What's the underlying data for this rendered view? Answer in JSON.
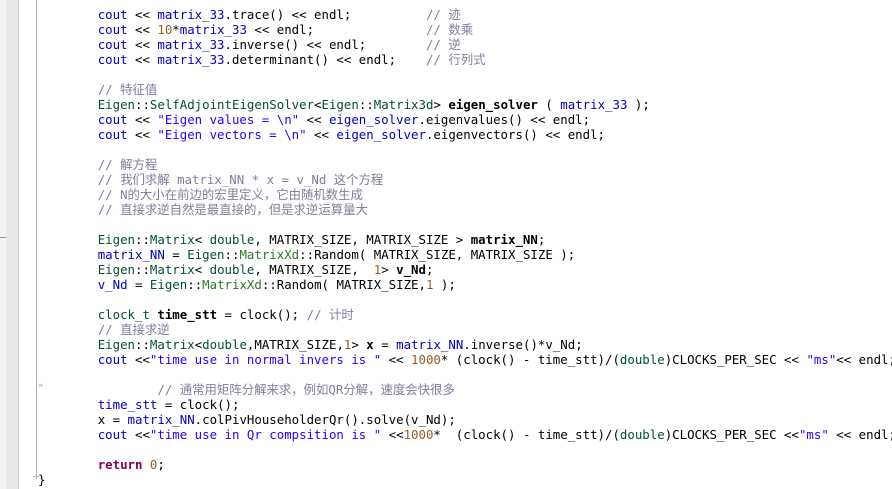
{
  "editor": {
    "lines": [
      {
        "indent": "    ",
        "tokens": [
          [
            "t-blue",
            "cout"
          ],
          [
            "t-plain",
            " << "
          ],
          [
            "t-blue",
            "matrix_33"
          ],
          [
            "t-plain",
            "."
          ],
          [
            "t-func",
            "trace"
          ],
          [
            "t-plain",
            "() << endl;"
          ],
          [
            "t-plain",
            "          "
          ],
          [
            "t-comment",
            "// 迹"
          ]
        ]
      },
      {
        "indent": "    ",
        "tokens": [
          [
            "t-blue",
            "cout"
          ],
          [
            "t-plain",
            " << "
          ],
          [
            "t-num",
            "10"
          ],
          [
            "t-plain",
            "*"
          ],
          [
            "t-blue",
            "matrix_33"
          ],
          [
            "t-plain",
            " << endl;"
          ],
          [
            "t-plain",
            "               "
          ],
          [
            "t-comment",
            "// 数乘"
          ]
        ]
      },
      {
        "indent": "    ",
        "tokens": [
          [
            "t-blue",
            "cout"
          ],
          [
            "t-plain",
            " << "
          ],
          [
            "t-blue",
            "matrix_33"
          ],
          [
            "t-plain",
            "."
          ],
          [
            "t-func",
            "inverse"
          ],
          [
            "t-plain",
            "() << endl;"
          ],
          [
            "t-plain",
            "        "
          ],
          [
            "t-comment",
            "// 逆"
          ]
        ]
      },
      {
        "indent": "    ",
        "tokens": [
          [
            "t-blue",
            "cout"
          ],
          [
            "t-plain",
            " << "
          ],
          [
            "t-blue",
            "matrix_33"
          ],
          [
            "t-plain",
            "."
          ],
          [
            "t-func",
            "determinant"
          ],
          [
            "t-plain",
            "() << endl;"
          ],
          [
            "t-plain",
            "    "
          ],
          [
            "t-comment",
            "// 行列式"
          ]
        ]
      },
      {
        "indent": "",
        "tokens": []
      },
      {
        "indent": "    ",
        "tokens": [
          [
            "t-comment",
            "// 特征值"
          ]
        ]
      },
      {
        "indent": "    ",
        "tokens": [
          [
            "t-ns",
            "Eigen"
          ],
          [
            "t-plain",
            "::"
          ],
          [
            "t-ns",
            "SelfAdjointEigenSolver"
          ],
          [
            "t-plain",
            "<"
          ],
          [
            "t-ns",
            "Eigen"
          ],
          [
            "t-plain",
            "::"
          ],
          [
            "t-ns",
            "Matrix3d"
          ],
          [
            "t-plain",
            "> "
          ],
          [
            "t-mvar",
            "eigen_solver"
          ],
          [
            "t-plain",
            " ( "
          ],
          [
            "t-blue",
            "matrix_33"
          ],
          [
            "t-plain",
            " );"
          ]
        ]
      },
      {
        "indent": "    ",
        "tokens": [
          [
            "t-blue",
            "cout"
          ],
          [
            "t-plain",
            " << "
          ],
          [
            "t-str",
            "\"Eigen values = \\n\""
          ],
          [
            "t-plain",
            " << "
          ],
          [
            "t-blue",
            "eigen_solver"
          ],
          [
            "t-plain",
            "."
          ],
          [
            "t-func",
            "eigenvalues"
          ],
          [
            "t-plain",
            "() << endl;"
          ]
        ]
      },
      {
        "indent": "    ",
        "tokens": [
          [
            "t-blue",
            "cout"
          ],
          [
            "t-plain",
            " << "
          ],
          [
            "t-str",
            "\"Eigen vectors = \\n\""
          ],
          [
            "t-plain",
            " << "
          ],
          [
            "t-blue",
            "eigen_solver"
          ],
          [
            "t-plain",
            "."
          ],
          [
            "t-func",
            "eigenvectors"
          ],
          [
            "t-plain",
            "() << endl;"
          ]
        ]
      },
      {
        "indent": "",
        "tokens": []
      },
      {
        "indent": "    ",
        "tokens": [
          [
            "t-comment",
            "// 解方程"
          ]
        ]
      },
      {
        "indent": "    ",
        "tokens": [
          [
            "t-comment",
            "// 我们求解 matrix_NN * x = v_Nd 这个方程"
          ]
        ]
      },
      {
        "indent": "    ",
        "tokens": [
          [
            "t-comment",
            "// N的大小在前边的宏里定义，它由随机数生成"
          ]
        ]
      },
      {
        "indent": "    ",
        "tokens": [
          [
            "t-comment",
            "// 直接求逆自然是最直接的，但是求逆运算量大"
          ]
        ]
      },
      {
        "indent": "",
        "tokens": []
      },
      {
        "indent": "    ",
        "tokens": [
          [
            "t-ns",
            "Eigen"
          ],
          [
            "t-plain",
            "::"
          ],
          [
            "t-ns",
            "Matrix"
          ],
          [
            "t-plain",
            "< "
          ],
          [
            "t-type",
            "double"
          ],
          [
            "t-plain",
            ", MATRIX_SIZE, MATRIX_SIZE > "
          ],
          [
            "t-mvar",
            "matrix_NN"
          ],
          [
            "t-plain",
            ";"
          ]
        ]
      },
      {
        "indent": "    ",
        "tokens": [
          [
            "t-blue",
            "matrix_NN"
          ],
          [
            "t-plain",
            " = "
          ],
          [
            "t-ns",
            "Eigen"
          ],
          [
            "t-plain",
            "::"
          ],
          [
            "t-green",
            "MatrixXd"
          ],
          [
            "t-plain",
            "::"
          ],
          [
            "t-func",
            "Random"
          ],
          [
            "t-plain",
            "( MATRIX_SIZE, MATRIX_SIZE );"
          ]
        ]
      },
      {
        "indent": "    ",
        "tokens": [
          [
            "t-ns",
            "Eigen"
          ],
          [
            "t-plain",
            "::"
          ],
          [
            "t-ns",
            "Matrix"
          ],
          [
            "t-plain",
            "< "
          ],
          [
            "t-type",
            "double"
          ],
          [
            "t-plain",
            ", MATRIX_SIZE,  "
          ],
          [
            "t-num",
            "1"
          ],
          [
            "t-plain",
            "> "
          ],
          [
            "t-mvar",
            "v_Nd"
          ],
          [
            "t-plain",
            ";"
          ]
        ]
      },
      {
        "indent": "    ",
        "tokens": [
          [
            "t-blue",
            "v_Nd"
          ],
          [
            "t-plain",
            " = "
          ],
          [
            "t-ns",
            "Eigen"
          ],
          [
            "t-plain",
            "::"
          ],
          [
            "t-green",
            "MatrixXd"
          ],
          [
            "t-plain",
            "::"
          ],
          [
            "t-func",
            "Random"
          ],
          [
            "t-plain",
            "( MATRIX_SIZE,"
          ],
          [
            "t-num",
            "1"
          ],
          [
            "t-plain",
            " );"
          ]
        ]
      },
      {
        "indent": "",
        "tokens": []
      },
      {
        "indent": "    ",
        "tokens": [
          [
            "t-type",
            "clock_t"
          ],
          [
            "t-plain",
            " "
          ],
          [
            "t-mvar",
            "time_stt"
          ],
          [
            "t-plain",
            " = "
          ],
          [
            "t-func",
            "clock"
          ],
          [
            "t-plain",
            "(); "
          ],
          [
            "t-comment",
            "// 计时"
          ]
        ]
      },
      {
        "indent": "    ",
        "tokens": [
          [
            "t-comment",
            "// 直接求逆"
          ]
        ]
      },
      {
        "indent": "    ",
        "tokens": [
          [
            "t-ns",
            "Eigen"
          ],
          [
            "t-plain",
            "::"
          ],
          [
            "t-ns",
            "Matrix"
          ],
          [
            "t-plain",
            "<"
          ],
          [
            "t-type",
            "double"
          ],
          [
            "t-plain",
            ",MATRIX_SIZE,"
          ],
          [
            "t-num",
            "1"
          ],
          [
            "t-plain",
            "> "
          ],
          [
            "t-mvar",
            "x"
          ],
          [
            "t-plain",
            " = "
          ],
          [
            "t-blue",
            "matrix_NN"
          ],
          [
            "t-plain",
            "."
          ],
          [
            "t-func",
            "inverse"
          ],
          [
            "t-plain",
            "()*v_Nd;"
          ]
        ]
      },
      {
        "indent": "    ",
        "tokens": [
          [
            "t-blue",
            "cout"
          ],
          [
            "t-plain",
            " <<"
          ],
          [
            "t-str",
            "\"time use in normal invers is \""
          ],
          [
            "t-plain",
            " << "
          ],
          [
            "t-num",
            "1000"
          ],
          [
            "t-plain",
            "* (clock() - time_stt)/("
          ],
          [
            "t-type",
            "double"
          ],
          [
            "t-plain",
            ")CLOCKS_PER_SEC << "
          ],
          [
            "t-str",
            "\"ms\""
          ],
          [
            "t-plain",
            "<< endl;"
          ]
        ]
      },
      {
        "indent": "",
        "tokens": []
      },
      {
        "indent": "        ",
        "tokens": [
          [
            "t-comment",
            "// 通常用矩阵分解来求，例如QR分解，速度会快很多"
          ]
        ]
      },
      {
        "indent": "    ",
        "tokens": [
          [
            "t-blue",
            "time_stt"
          ],
          [
            "t-plain",
            " = "
          ],
          [
            "t-func",
            "clock"
          ],
          [
            "t-plain",
            "();"
          ]
        ]
      },
      {
        "indent": "    ",
        "tokens": [
          [
            "t-plain",
            "x = "
          ],
          [
            "t-blue",
            "matrix_NN"
          ],
          [
            "t-plain",
            "."
          ],
          [
            "t-func",
            "colPivHouseholderQr"
          ],
          [
            "t-plain",
            "()."
          ],
          [
            "t-func",
            "solve"
          ],
          [
            "t-plain",
            "(v_Nd);"
          ]
        ]
      },
      {
        "indent": "    ",
        "tokens": [
          [
            "t-blue",
            "cout"
          ],
          [
            "t-plain",
            " <<"
          ],
          [
            "t-str",
            "\"time use in Qr compsition is \""
          ],
          [
            "t-plain",
            " <<"
          ],
          [
            "t-num",
            "1000"
          ],
          [
            "t-plain",
            "*  (clock() - time_stt)/("
          ],
          [
            "t-type",
            "double"
          ],
          [
            "t-plain",
            ")CLOCKS_PER_SEC <<"
          ],
          [
            "t-str",
            "\"ms\""
          ],
          [
            "t-plain",
            " << endl;"
          ]
        ]
      },
      {
        "indent": "",
        "tokens": []
      },
      {
        "indent": "    ",
        "tokens": [
          [
            "t-kw",
            "return"
          ],
          [
            "t-plain",
            " "
          ],
          [
            "t-num",
            "0"
          ],
          [
            "t-plain",
            ";"
          ]
        ]
      },
      {
        "indent": "",
        "tokens": [
          [
            "t-plain",
            "}"
          ]
        ]
      }
    ],
    "gutter_marker": "»"
  }
}
